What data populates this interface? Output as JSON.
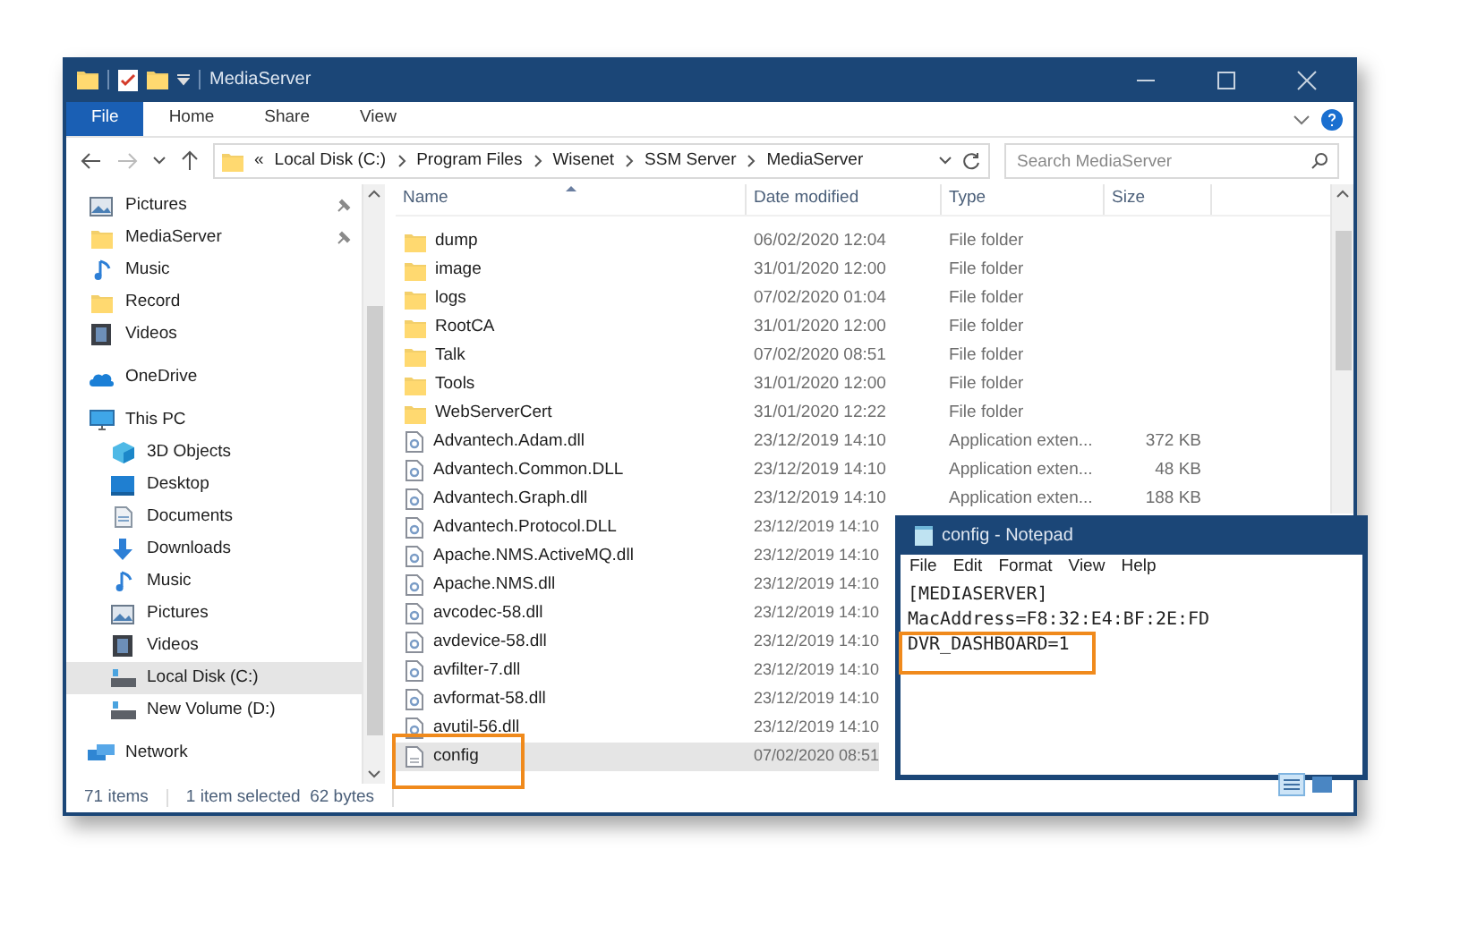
{
  "explorer": {
    "title": "MediaServer",
    "ribbon_tabs": [
      {
        "label": "File",
        "selected": true
      },
      {
        "label": "Home",
        "selected": false
      },
      {
        "label": "Share",
        "selected": false
      },
      {
        "label": "View",
        "selected": false
      }
    ],
    "address": {
      "overflow": "«",
      "segments": [
        "Local Disk (C:)",
        "Program Files",
        "Wisenet",
        "SSM Server",
        "MediaServer"
      ]
    },
    "search": {
      "placeholder": "Search MediaServer"
    },
    "nav": [
      {
        "label": "Pictures",
        "pinned": true,
        "selected": false
      },
      {
        "label": "MediaServer",
        "pinned": true,
        "selected": false
      },
      {
        "label": "Music",
        "pinned": false,
        "selected": false
      },
      {
        "label": "Record",
        "pinned": false,
        "selected": false
      },
      {
        "label": "Videos",
        "pinned": false,
        "selected": false
      },
      {
        "label": "OneDrive",
        "pinned": false,
        "selected": false
      },
      {
        "label": "This PC",
        "pinned": false,
        "selected": false,
        "children": [
          {
            "label": "3D Objects",
            "pinned": false,
            "selected": false
          },
          {
            "label": "Desktop",
            "pinned": false,
            "selected": false
          },
          {
            "label": "Documents",
            "pinned": false,
            "selected": false
          },
          {
            "label": "Downloads",
            "pinned": false,
            "selected": false
          },
          {
            "label": "Music",
            "pinned": false,
            "selected": false
          },
          {
            "label": "Pictures",
            "pinned": false,
            "selected": false
          },
          {
            "label": "Videos",
            "pinned": false,
            "selected": false
          },
          {
            "label": "Local Disk (C:)",
            "pinned": false,
            "selected": true
          },
          {
            "label": "New Volume (D:)",
            "pinned": false,
            "selected": false
          }
        ]
      },
      {
        "label": "Network",
        "pinned": false,
        "selected": false
      }
    ],
    "columns": [
      "Name",
      "Date modified",
      "Type",
      "Size"
    ],
    "files": [
      {
        "name": "dump",
        "kind": "folder",
        "date": "06/02/2020 12:04",
        "type": "File folder",
        "selected": false
      },
      {
        "name": "image",
        "kind": "folder",
        "date": "31/01/2020 12:00",
        "type": "File folder",
        "selected": false
      },
      {
        "name": "logs",
        "kind": "folder",
        "date": "07/02/2020 01:04",
        "type": "File folder",
        "selected": false
      },
      {
        "name": "RootCA",
        "kind": "folder",
        "date": "31/01/2020 12:00",
        "type": "File folder",
        "selected": false
      },
      {
        "name": "Talk",
        "kind": "folder",
        "date": "07/02/2020 08:51",
        "type": "File folder",
        "selected": false
      },
      {
        "name": "Tools",
        "kind": "folder",
        "date": "31/01/2020 12:00",
        "type": "File folder",
        "selected": false
      },
      {
        "name": "WebServerCert",
        "kind": "folder",
        "date": "31/01/2020 12:22",
        "type": "File folder",
        "selected": false
      },
      {
        "name": "Advantech.Adam.dll",
        "kind": "dll",
        "date": "23/12/2019 14:10",
        "type": "Application exten...",
        "size": "372 KB",
        "selected": false
      },
      {
        "name": "Advantech.Common.DLL",
        "kind": "dll",
        "date": "23/12/2019 14:10",
        "type": "Application exten...",
        "size": "48 KB",
        "selected": false
      },
      {
        "name": "Advantech.Graph.dll",
        "kind": "dll",
        "date": "23/12/2019 14:10",
        "type": "Application exten...",
        "size": "188 KB",
        "selected": false
      },
      {
        "name": "Advantech.Protocol.DLL",
        "kind": "dll",
        "date": "23/12/2019 14:10",
        "selected": false
      },
      {
        "name": "Apache.NMS.ActiveMQ.dll",
        "kind": "dll",
        "date": "23/12/2019 14:10",
        "selected": false
      },
      {
        "name": "Apache.NMS.dll",
        "kind": "dll",
        "date": "23/12/2019 14:10",
        "selected": false
      },
      {
        "name": "avcodec-58.dll",
        "kind": "dll",
        "date": "23/12/2019 14:10",
        "selected": false
      },
      {
        "name": "avdevice-58.dll",
        "kind": "dll",
        "date": "23/12/2019 14:10",
        "selected": false
      },
      {
        "name": "avfilter-7.dll",
        "kind": "dll",
        "date": "23/12/2019 14:10",
        "selected": false
      },
      {
        "name": "avformat-58.dll",
        "kind": "dll",
        "date": "23/12/2019 14:10",
        "selected": false
      },
      {
        "name": "avutil-56.dll",
        "kind": "dll",
        "date": "23/12/2019 14:10",
        "selected": false
      },
      {
        "name": "config",
        "kind": "file",
        "date": "07/02/2020 08:51",
        "selected": true
      }
    ],
    "status": {
      "count": "71 items",
      "selection": "1 item selected  62 bytes"
    }
  },
  "notepad": {
    "title": "config - Notepad",
    "menu": [
      "File",
      "Edit",
      "Format",
      "View",
      "Help"
    ],
    "lines": [
      "[MEDIASERVER]",
      "MacAddress=F8:32:E4:BF:2E:FD",
      "DVR_DASHBOARD=1"
    ]
  }
}
